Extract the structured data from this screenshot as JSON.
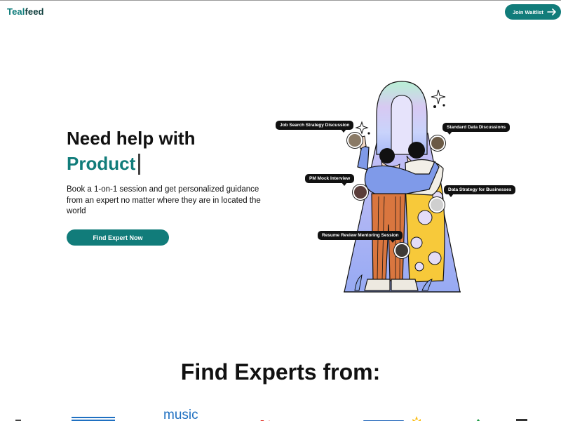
{
  "header": {
    "logo_part1": "Teal",
    "logo_part2": "feed",
    "join_label": "Join Waitlist"
  },
  "hero": {
    "title": "Need help with",
    "rotating_word": "Product",
    "description": "Book a 1-on-1 session and get personalized guidance from an expert no matter where they are in located the world",
    "cta_label": "Find Expert Now"
  },
  "session_tags": [
    "Job Search Strategy Discussion",
    "Standard Data Discussions",
    "PM Mock Interview",
    "Data Strategy for Businesses",
    "Resume Review Mentoring Session"
  ],
  "experts_section": {
    "title": "Find Experts from:",
    "logo_text_music": "music"
  },
  "colors": {
    "brand": "#117c7a",
    "text": "#111111"
  }
}
